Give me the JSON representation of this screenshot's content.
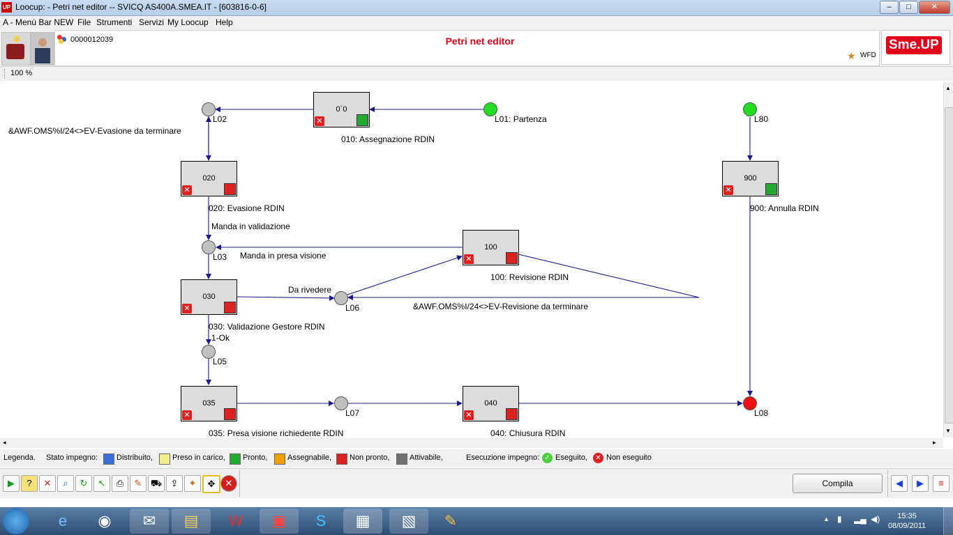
{
  "window": {
    "app_icon_text": "UP",
    "title": "Loocup:  - Petri net editor -- SVICQ AS400A.SMEA.IT - [603816-0-6]",
    "minimize": "–",
    "maximize": "□",
    "close": "✕"
  },
  "menu": [
    "A - Menù Bar NEW",
    "File",
    "Strumenti",
    "Servizi",
    "My Loocup",
    "Help"
  ],
  "header": {
    "code": "0000012039",
    "page_title": "Petri net editor",
    "wfd_label": "WFD",
    "logo_text": "Sme.UP"
  },
  "zoom": "100 %",
  "diagram": {
    "places": [
      {
        "id": "L02",
        "label": "L02",
        "color": "#c0c0c0"
      },
      {
        "id": "L01",
        "label": "L01: Partenza",
        "color": "#22dd22"
      },
      {
        "id": "L80",
        "label": "L80",
        "color": "#22dd22"
      },
      {
        "id": "L03",
        "label": "L03",
        "color": "#c0c0c0"
      },
      {
        "id": "L06",
        "label": "L06",
        "color": "#c0c0c0"
      },
      {
        "id": "L05",
        "label": "L05",
        "color": "#c0c0c0"
      },
      {
        "id": "L07",
        "label": "L07",
        "color": "#c0c0c0"
      },
      {
        "id": "L08",
        "label": "L08",
        "color": "#ee1111"
      }
    ],
    "transitions": [
      {
        "id": "010",
        "code": "0´0",
        "label": "010: Assegnazione RDIN",
        "status_color": "#22aa33"
      },
      {
        "id": "020",
        "code": "020",
        "label": "020: Evasione RDIN",
        "status_color": "#dd2222"
      },
      {
        "id": "900",
        "code": "900",
        "label": "900: Annulla RDIN",
        "status_color": "#22aa33"
      },
      {
        "id": "100",
        "code": "100",
        "label": "100: Revisione RDIN",
        "status_color": "#dd2222"
      },
      {
        "id": "030",
        "code": "030",
        "label": "030: Validazione Gestore RDIN",
        "status_color": "#dd2222"
      },
      {
        "id": "035",
        "code": "035",
        "label": "035: Presa visione richiedente RDIN",
        "status_color": "#dd2222"
      },
      {
        "id": "040",
        "code": "040",
        "label": "040: Chiusura RDIN",
        "status_color": "#dd2222"
      }
    ],
    "arc_labels": {
      "evasione_cond": "&AWF.OMS%I/24<>EV-Evasione da terminare",
      "manda_validazione": "Manda in validazione",
      "manda_presa_visione": "Manda in presa visione",
      "da_rivedere": "Da rivedere",
      "revisione_cond": "&AWF.OMS%I/24<>EV-Revisione da terminare",
      "ok": "1-Ok"
    }
  },
  "legend": {
    "title": "Legenda.",
    "stato_label": "Stato impegno:",
    "states": [
      {
        "label": "Distribuito,",
        "color": "#3a6fd8"
      },
      {
        "label": "Preso in carico,",
        "color": "#f2ee8a"
      },
      {
        "label": "Pronto,",
        "color": "#22aa33"
      },
      {
        "label": "Assegnabile,",
        "color": "#f0a000"
      },
      {
        "label": "Non pronto,",
        "color": "#dd2222"
      },
      {
        "label": "Attivabile,",
        "color": "#707070"
      }
    ],
    "esecuzione_label": "Esecuzione impegno:",
    "eseguito": "Eseguito,",
    "non_eseguito": "Non eseguito"
  },
  "toolbar": {
    "icons": [
      "play-icon",
      "help-icon",
      "delete-icon",
      "zoom-icon",
      "refresh-icon",
      "undo-arrow-icon",
      "print-icon",
      "edit-doc-icon",
      "cart-icon",
      "export-icon",
      "tool-icon",
      "move-icon",
      "cancel-icon"
    ],
    "compila_label": "Compila"
  },
  "taskbar": {
    "time": "15:35",
    "date": "08/09/2011"
  }
}
